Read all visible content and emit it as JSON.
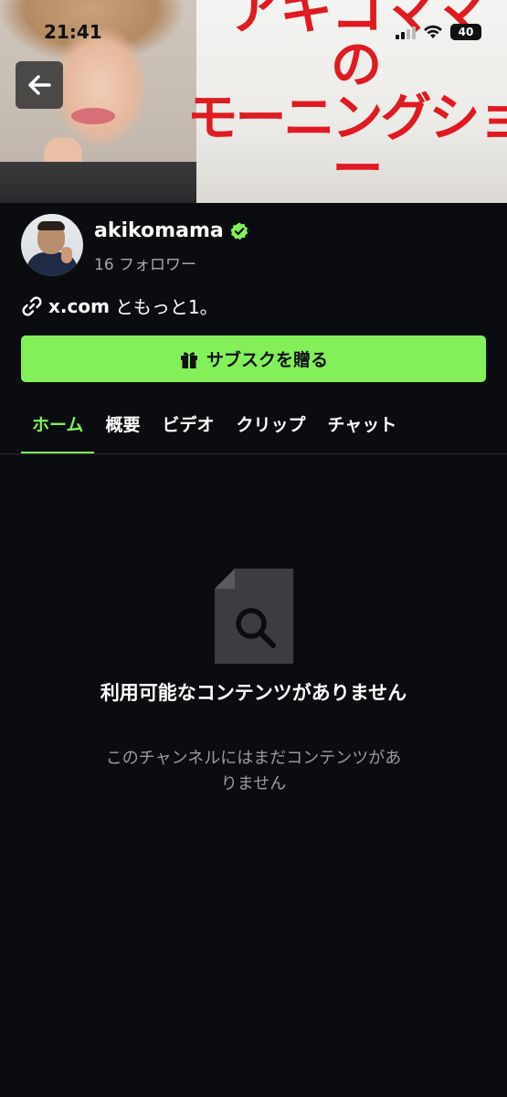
{
  "status_bar": {
    "time": "21:41",
    "battery": "40"
  },
  "banner": {
    "title_line1": "アキコママ",
    "title_line2": "の",
    "title_line3": "モーニングショー"
  },
  "profile": {
    "channel_name": "akikomama",
    "followers": "16 フォロワー",
    "link_url": "x.com",
    "link_suffix": "ともっと1。"
  },
  "subscribe": {
    "label": "サブスクを贈る"
  },
  "tabs": [
    {
      "label": "ホーム",
      "active": true
    },
    {
      "label": "概要",
      "active": false
    },
    {
      "label": "ビデオ",
      "active": false
    },
    {
      "label": "クリップ",
      "active": false
    },
    {
      "label": "チャット",
      "active": false
    }
  ],
  "empty_state": {
    "title": "利用可能なコンテンツがありません",
    "subtitle": "このチャンネルにはまだコンテンツがありません"
  },
  "colors": {
    "accent": "#83f05a",
    "background": "#0b0c0f",
    "banner_red": "#e01a22"
  }
}
